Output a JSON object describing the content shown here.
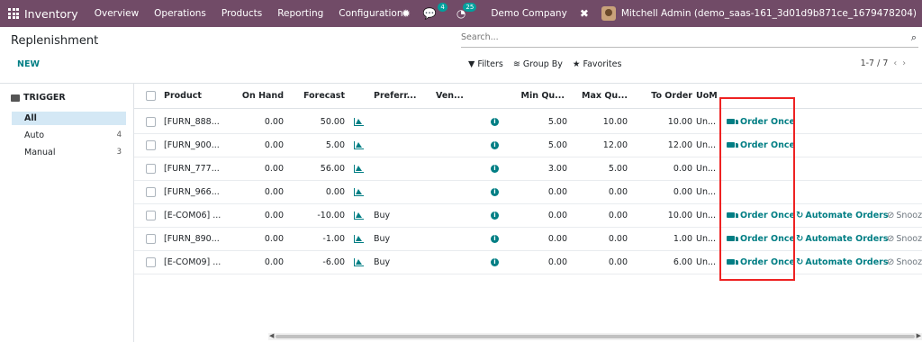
{
  "navbar": {
    "app": "Inventory",
    "menu": [
      "Overview",
      "Operations",
      "Products",
      "Reporting",
      "Configuration"
    ],
    "chat_badge": "4",
    "activity_badge": "25",
    "company": "Demo Company",
    "user": "Mitchell Admin (demo_saas-161_3d01d9b871ce_1679478204)"
  },
  "control": {
    "title": "Replenishment",
    "new_label": "NEW",
    "search_placeholder": "Search...",
    "filters": "Filters",
    "group_by": "Group By",
    "favorites": "Favorites",
    "pager": "1-7 / 7"
  },
  "sidebar": {
    "title": "TRIGGER",
    "items": [
      {
        "label": "All",
        "count": ""
      },
      {
        "label": "Auto",
        "count": "4"
      },
      {
        "label": "Manual",
        "count": "3"
      }
    ]
  },
  "table": {
    "headers": [
      "Product",
      "On Hand",
      "Forecast",
      "Preferr...",
      "Ven...",
      "Min Qu...",
      "Max Qu...",
      "To Order",
      "UoM"
    ],
    "rows": [
      {
        "product": "[FURN_888...",
        "on_hand": "0.00",
        "forecast": "50.00",
        "route": "",
        "min": "5.00",
        "max": "10.00",
        "to_order": "10.00",
        "uom": "Un...",
        "order_once": "Order Once",
        "automate": "",
        "snooze": ""
      },
      {
        "product": "[FURN_900...",
        "on_hand": "0.00",
        "forecast": "5.00",
        "route": "",
        "min": "5.00",
        "max": "12.00",
        "to_order": "12.00",
        "uom": "Un...",
        "order_once": "Order Once",
        "automate": "",
        "snooze": ""
      },
      {
        "product": "[FURN_777...",
        "on_hand": "0.00",
        "forecast": "56.00",
        "route": "",
        "min": "3.00",
        "max": "5.00",
        "to_order": "0.00",
        "uom": "Un...",
        "order_once": "",
        "automate": "",
        "snooze": ""
      },
      {
        "product": "[FURN_966...",
        "on_hand": "0.00",
        "forecast": "0.00",
        "route": "",
        "min": "0.00",
        "max": "0.00",
        "to_order": "0.00",
        "uom": "Un...",
        "order_once": "",
        "automate": "",
        "snooze": ""
      },
      {
        "product": "[E-COM06] ...",
        "on_hand": "0.00",
        "forecast": "-10.00",
        "route": "Buy",
        "min": "0.00",
        "max": "0.00",
        "to_order": "10.00",
        "uom": "Un...",
        "order_once": "Order Once",
        "automate": "Automate Orders",
        "snooze": "Snooz"
      },
      {
        "product": "[FURN_890...",
        "on_hand": "0.00",
        "forecast": "-1.00",
        "route": "Buy",
        "min": "0.00",
        "max": "0.00",
        "to_order": "1.00",
        "uom": "Un...",
        "order_once": "Order Once",
        "automate": "Automate Orders",
        "snooze": "Snooz"
      },
      {
        "product": "[E-COM09] ...",
        "on_hand": "0.00",
        "forecast": "-6.00",
        "route": "Buy",
        "min": "0.00",
        "max": "0.00",
        "to_order": "6.00",
        "uom": "Un...",
        "order_once": "Order Once",
        "automate": "Automate Orders",
        "snooze": "Snooz"
      }
    ]
  },
  "colors": {
    "brand": "#714b67",
    "accent": "#017e84",
    "highlight": "#e22222"
  }
}
